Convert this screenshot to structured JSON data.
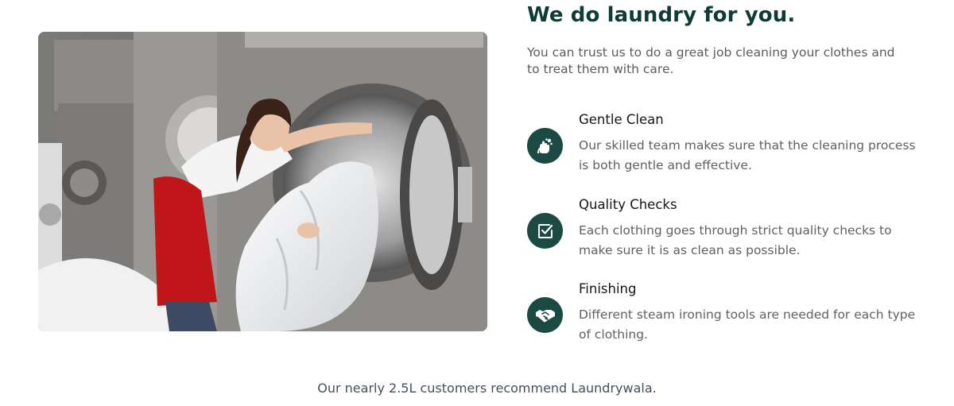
{
  "photo": {
    "subject": "woman-loading-industrial-washing-machine"
  },
  "section": {
    "heading": "We do laundry for you.",
    "intro": "You can trust us to do a great job cleaning your clothes and to treat them with care."
  },
  "features": [
    {
      "title": "Gentle Clean",
      "description": "Our skilled team makes sure that the cleaning process is both gentle and effective.",
      "icon": "hands-bubbles-icon"
    },
    {
      "title": "Quality Checks",
      "description": "Each clothing goes through strict quality checks to make sure it is as clean as possible.",
      "icon": "checkbox-icon"
    },
    {
      "title": "Finishing",
      "description": "Different steam ironing tools are needed for each type of clothing.",
      "icon": "handshake-icon"
    }
  ],
  "footer": {
    "tagline": "Our nearly 2.5L customers recommend Laundrywala."
  },
  "colors": {
    "heading": "#0e3b36",
    "icon_bg": "#1a4a43",
    "body_text": "#616161",
    "tagline": "#45505f"
  }
}
